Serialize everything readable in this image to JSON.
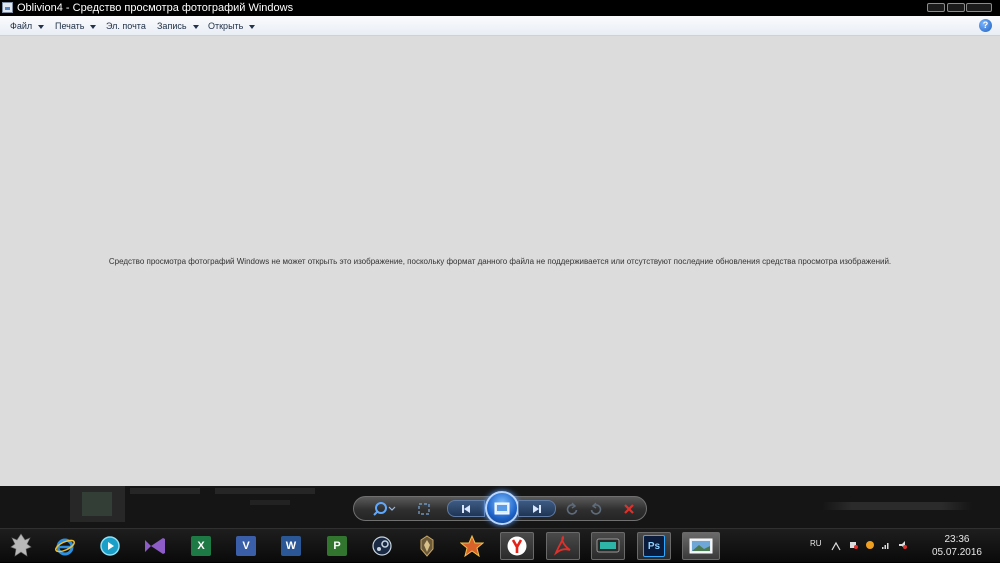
{
  "window": {
    "title": "Oblivion4 - Средство просмотра фотографий Windows"
  },
  "menu": {
    "items": [
      {
        "label": "Файл",
        "has_dropdown": true
      },
      {
        "label": "Печать",
        "has_dropdown": true
      },
      {
        "label": "Эл. почта",
        "has_dropdown": false
      },
      {
        "label": "Запись",
        "has_dropdown": true
      },
      {
        "label": "Открыть",
        "has_dropdown": true
      }
    ],
    "help_icon": "help-icon",
    "help_label": "?"
  },
  "content": {
    "message": "Средство просмотра фотографий Windows не может открыть это изображение, поскольку формат данного файла не поддерживается или отсутствуют последние обновления средства просмотра изображений."
  },
  "controls": {
    "buttons": [
      "zoom",
      "actual-size",
      "previous",
      "slideshow",
      "next",
      "rotate-counterclockwise",
      "rotate-clockwise",
      "delete"
    ]
  },
  "taskbar": {
    "apps": [
      "skyrim",
      "internet-explorer",
      "media-app",
      "visual-studio",
      "excel",
      "visio",
      "word",
      "project",
      "steam",
      "oblivion",
      "game",
      "yandex-browser",
      "acrobat",
      "monitor-app",
      "photoshop",
      "photo-viewer"
    ],
    "letters": {
      "excel": "X",
      "visio": "V",
      "word": "W",
      "project": "P",
      "photoshop": "Ps"
    },
    "colors": {
      "excel": "#1d7a44",
      "visio": "#3b5ea8",
      "word": "#2b5797",
      "project": "#31752f",
      "photoshop": "#0a1b3b"
    }
  },
  "tray": {
    "language": "RU",
    "time": "23:36",
    "date": "05.07.2016"
  }
}
